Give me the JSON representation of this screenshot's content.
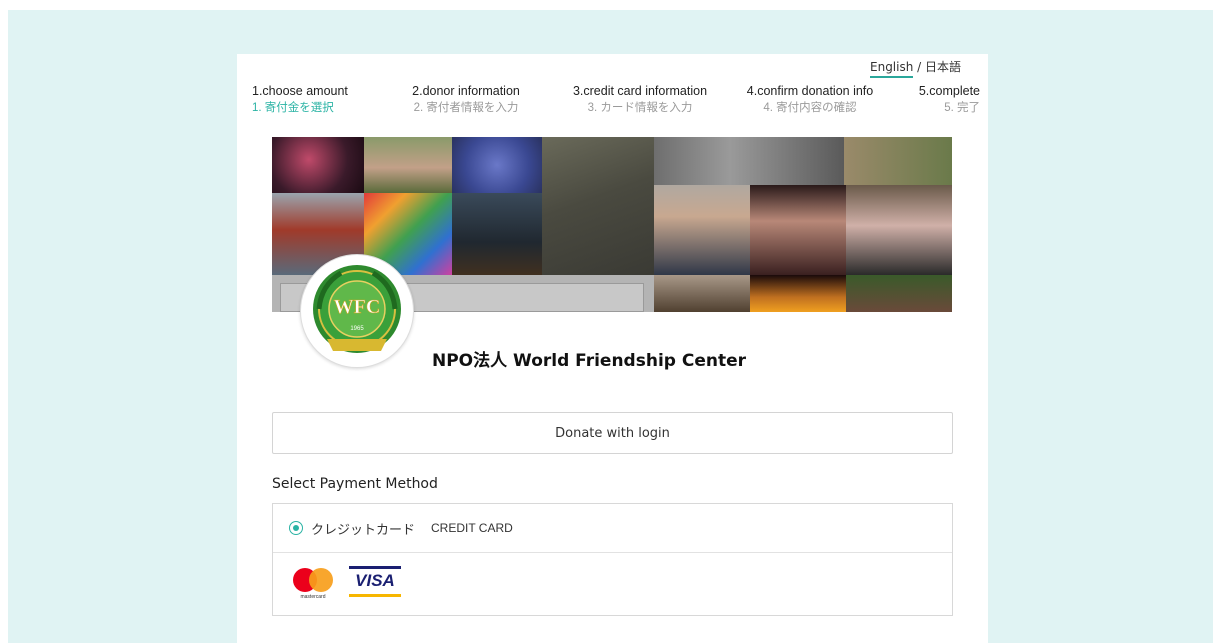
{
  "language_switch": {
    "english": "English",
    "separator": "/",
    "japanese": "日本語"
  },
  "steps": [
    {
      "en": "1.choose amount",
      "ja": "1. 寄付金を選択"
    },
    {
      "en": "2.donor information",
      "ja": "2. 寄付者情報を入力"
    },
    {
      "en": "3.credit card information",
      "ja": "3. カード情報を入力"
    },
    {
      "en": "4.confirm donation info",
      "ja": "4. 寄付内容の確認"
    },
    {
      "en": "5.complete",
      "ja": "5. 完了"
    }
  ],
  "active_step": 1,
  "organization": {
    "name": "NPO法人 World Friendship Center",
    "logo_text": "WFC",
    "logo_year": "1965"
  },
  "login_button": "Donate with login",
  "payment": {
    "title": "Select Payment Method",
    "method_ja": "クレジットカード",
    "method_en": "CREDIT CARD",
    "mastercard_text": "mastercard",
    "visa_text": "VISA"
  },
  "colors": {
    "accent": "#2ab3a4",
    "page_background": "#e0f3f3",
    "mastercard_red": "#eb001b",
    "mastercard_orange": "#f79e1b",
    "visa_blue": "#1a1f71",
    "visa_gold": "#f7b600"
  }
}
